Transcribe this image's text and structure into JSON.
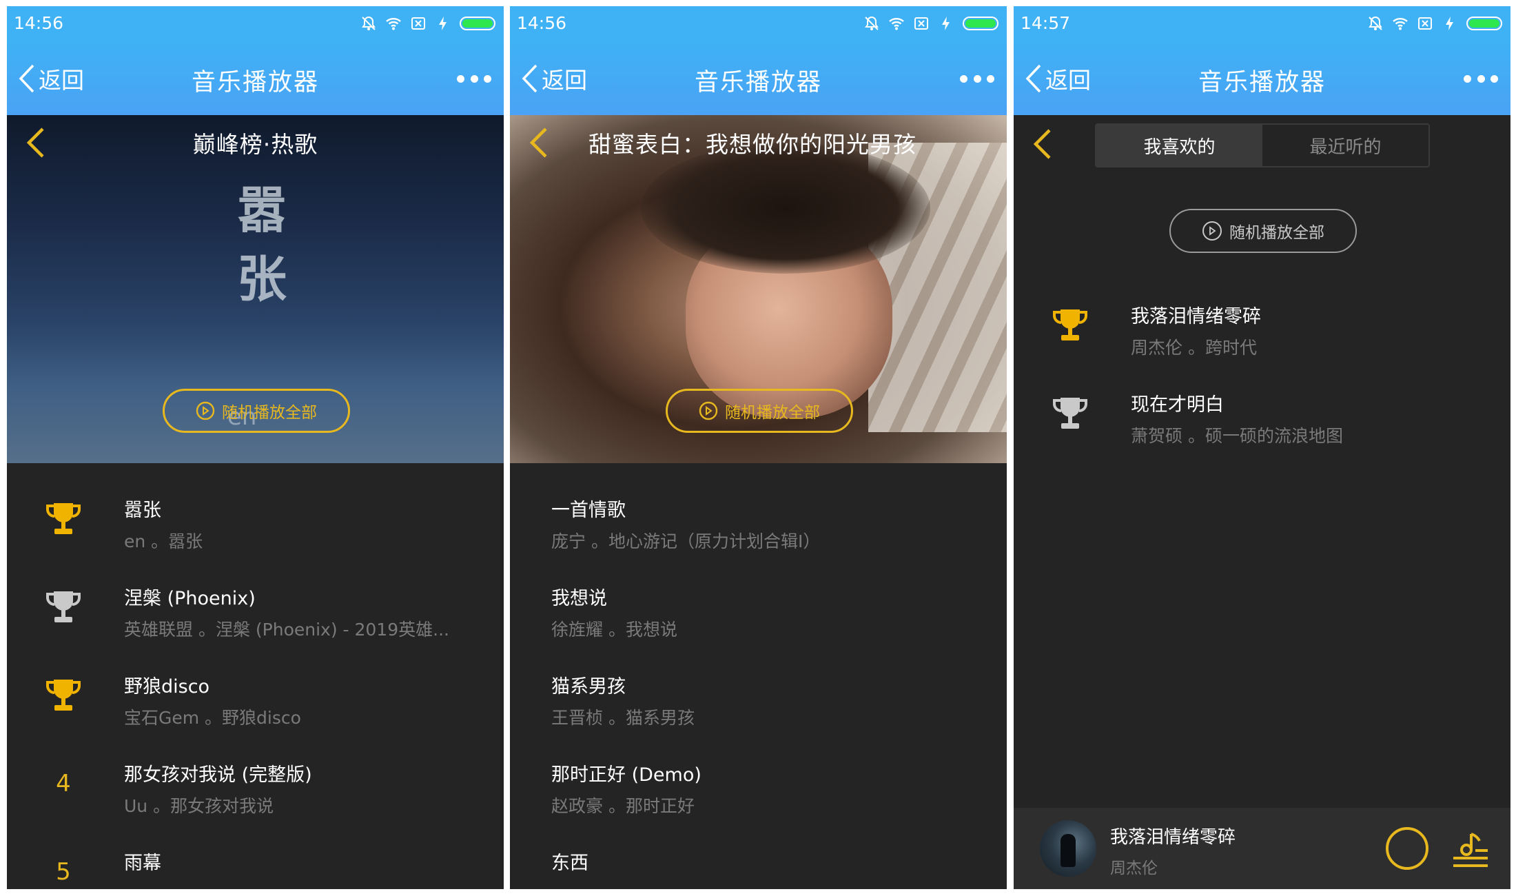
{
  "colors": {
    "header_blue": "#3fb1f5",
    "accent_gold": "#e8b81f",
    "list_background": "#242424",
    "battery_green": "#2ee64e"
  },
  "screens": [
    {
      "status": {
        "time": "14:56",
        "icons": [
          "mute-bell-icon",
          "wifi-icon",
          "sim-x-icon",
          "charging-bolt-icon",
          "battery-icon"
        ]
      },
      "nav": {
        "back_label": "返回",
        "title": "音乐播放器",
        "more_icon": "more-dots-icon"
      },
      "banner": {
        "title": "巅峰榜·热歌",
        "artwork_text": [
          "嚣",
          "张"
        ],
        "artwork_watermark": "en",
        "shuffle_label": "随机播放全部"
      },
      "songs": [
        {
          "rank": "1",
          "rank_icon": "gold-trophy-icon",
          "title": "嚣张",
          "subtitle": "en 。嚣张"
        },
        {
          "rank": "2",
          "rank_icon": "silver-trophy-icon",
          "title": "涅槃 (Phoenix)",
          "subtitle": "英雄联盟 。涅槃 (Phoenix) - 2019英雄..."
        },
        {
          "rank": "3",
          "rank_icon": "gold-trophy-icon",
          "title": "野狼disco",
          "subtitle": "宝石Gem 。野狼disco"
        },
        {
          "rank": "4",
          "title": "那女孩对我说 (完整版)",
          "subtitle": "Uu 。那女孩对我说"
        },
        {
          "rank": "5",
          "title": "雨幕",
          "subtitle": ""
        }
      ]
    },
    {
      "status": {
        "time": "14:56"
      },
      "nav": {
        "back_label": "返回",
        "title": "音乐播放器"
      },
      "banner": {
        "title": "甜蜜表白：我想做你的阳光男孩",
        "shuffle_label": "随机播放全部"
      },
      "songs": [
        {
          "title": "一首情歌",
          "subtitle": "庞宁 。地心游记（原力计划合辑I）"
        },
        {
          "title": "我想说",
          "subtitle": "徐旌耀 。我想说"
        },
        {
          "title": "猫系男孩",
          "subtitle": "王晋桢 。猫系男孩"
        },
        {
          "title": "那时正好 (Demo)",
          "subtitle": "赵政豪 。那时正好"
        },
        {
          "title": "东西",
          "subtitle": ""
        }
      ]
    },
    {
      "status": {
        "time": "14:57"
      },
      "nav": {
        "back_label": "返回",
        "title": "音乐播放器"
      },
      "tabs": [
        {
          "label": "我喜欢的",
          "active": true
        },
        {
          "label": "最近听的",
          "active": false
        }
      ],
      "shuffle_label": "随机播放全部",
      "songs": [
        {
          "rank_icon": "gold-trophy-icon",
          "title": "我落泪情绪零碎",
          "subtitle": "周杰伦 。跨时代"
        },
        {
          "rank_icon": "silver-trophy-icon",
          "title": "现在才明白",
          "subtitle": "萧贺硕 。硕一硕的流浪地图"
        }
      ],
      "mini_player": {
        "title": "我落泪情绪零碎",
        "artist": "周杰伦",
        "play_icon": "play-circle-icon",
        "queue_icon": "playlist-icon"
      }
    }
  ]
}
